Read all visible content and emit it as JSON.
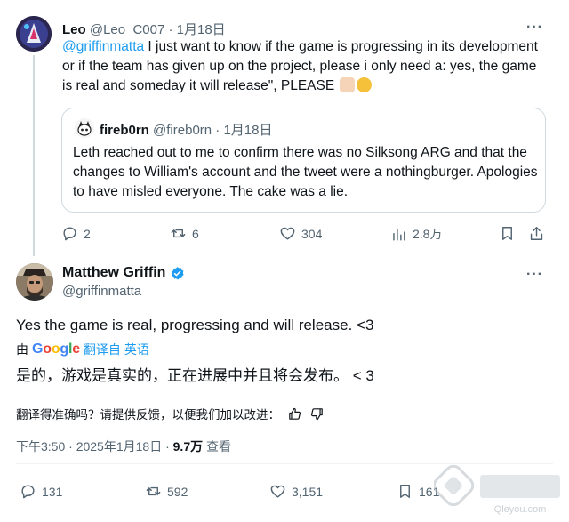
{
  "tweet1": {
    "name": "Leo",
    "handle": "@Leo_C007",
    "sep": "·",
    "date": "1月18日",
    "mention": "@griffinmatta",
    "text": " I just want to know if the game is progressing in its development or if the team has given up on the project, please i only need a: yes, the game is real and someday it will release\", PLEASE",
    "more": "···",
    "quote": {
      "name": "fireb0rn",
      "handle": "@fireb0rn",
      "sep": "·",
      "date": "1月18日",
      "text": "Leth reached out to me to confirm there was no Silksong ARG and that the changes to William's account and the tweet were a nothingburger. Apologies to have misled everyone. The cake was a lie."
    },
    "actions": {
      "replies": "2",
      "reposts": "6",
      "likes": "304",
      "views": "2.8万"
    }
  },
  "tweet2": {
    "name": "Matthew Griffin",
    "handle": "@griffinmatta",
    "more": "···",
    "text": "Yes the game is real, progressing and will release. <3",
    "translate_prefix": "由",
    "translate_brand": "Google",
    "translate_suffix": "翻译自 英语",
    "translated_text": "是的，游戏是真实的，正在进展中并且将会发布。 < 3",
    "feedback_text": "翻译得准确吗？请提供反馈，以便我们加以改进：",
    "time": "下午3:50 · 2025年1月18日 ·",
    "views_count": "9.7万",
    "views_label": "查看",
    "actions": {
      "replies": "131",
      "reposts": "592",
      "likes": "3,151",
      "bookmarks": "161"
    }
  },
  "watermark": {
    "brand": "Qleyou.com"
  },
  "colors": {
    "accent": "#1d9bf0",
    "muted": "#536471",
    "border": "#cfd9de",
    "verified": "#1d9bf0"
  }
}
